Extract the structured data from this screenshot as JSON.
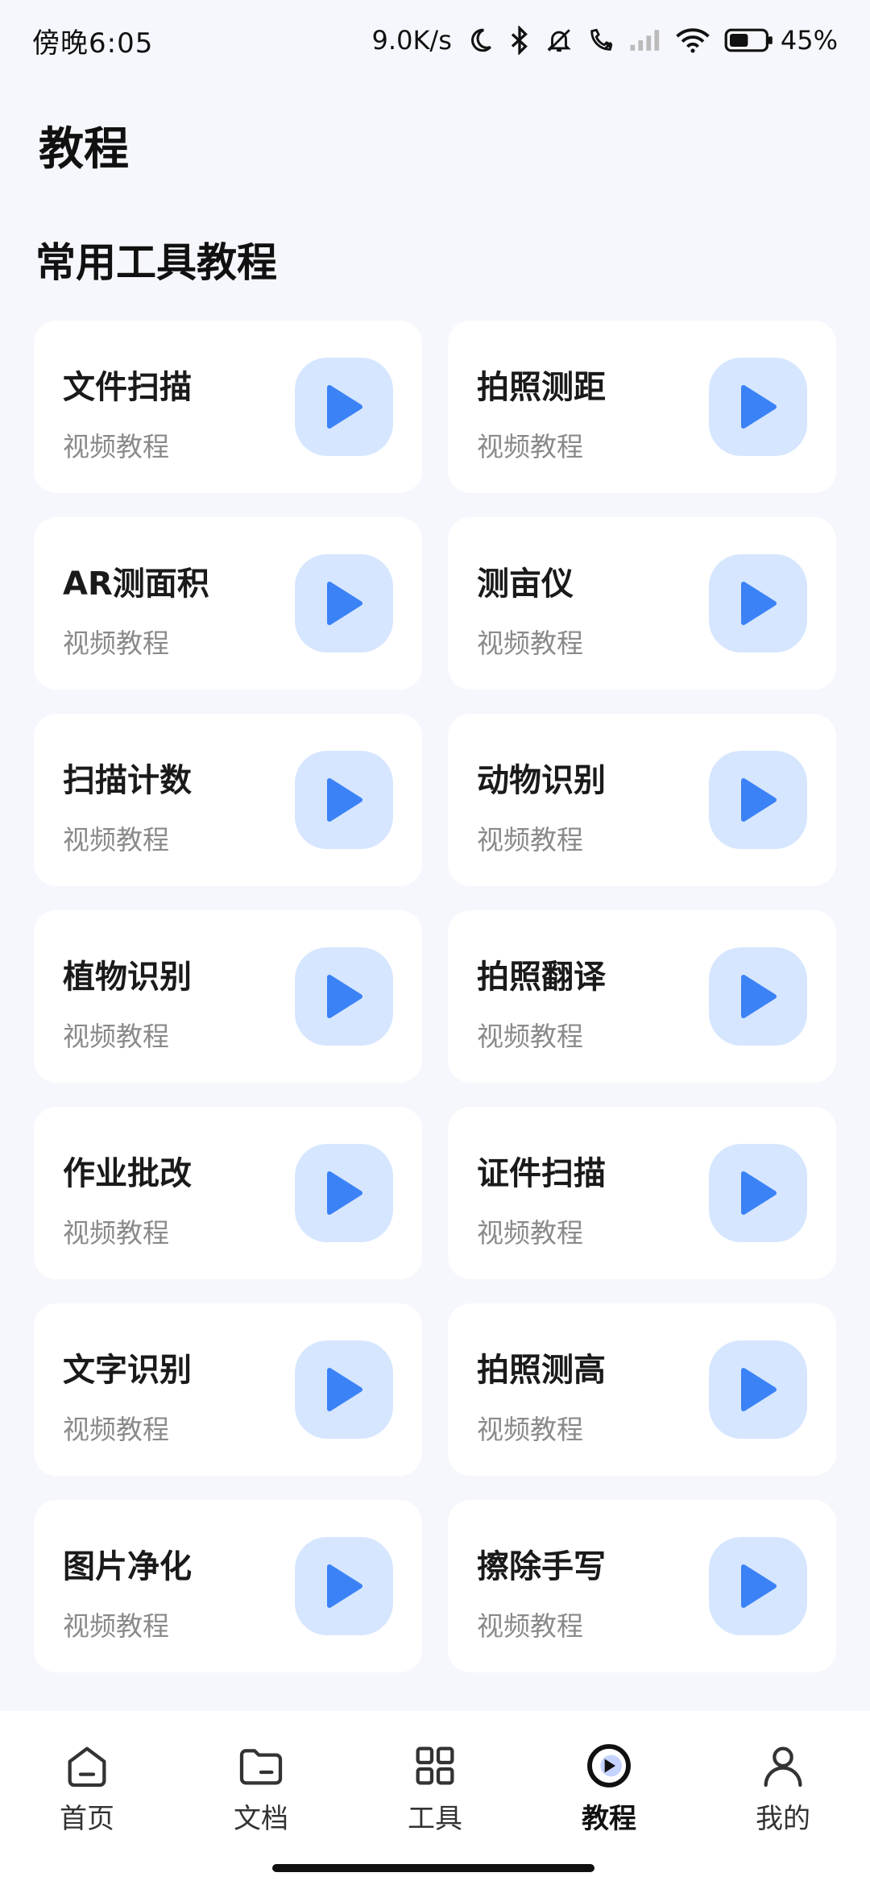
{
  "status": {
    "time": "傍晚6:05",
    "speed": "9.0K/s",
    "battery": "45%"
  },
  "header": {
    "title": "教程"
  },
  "section": {
    "title": "常用工具教程"
  },
  "cards": [
    {
      "title": "文件扫描",
      "subtitle": "视频教程"
    },
    {
      "title": "拍照测距",
      "subtitle": "视频教程"
    },
    {
      "title": "AR测面积",
      "subtitle": "视频教程"
    },
    {
      "title": "测亩仪",
      "subtitle": "视频教程"
    },
    {
      "title": "扫描计数",
      "subtitle": "视频教程"
    },
    {
      "title": "动物识别",
      "subtitle": "视频教程"
    },
    {
      "title": "植物识别",
      "subtitle": "视频教程"
    },
    {
      "title": "拍照翻译",
      "subtitle": "视频教程"
    },
    {
      "title": "作业批改",
      "subtitle": "视频教程"
    },
    {
      "title": "证件扫描",
      "subtitle": "视频教程"
    },
    {
      "title": "文字识别",
      "subtitle": "视频教程"
    },
    {
      "title": "拍照测高",
      "subtitle": "视频教程"
    },
    {
      "title": "图片净化",
      "subtitle": "视频教程"
    },
    {
      "title": "擦除手写",
      "subtitle": "视频教程"
    }
  ],
  "nav": {
    "items": [
      {
        "label": "首页",
        "icon": "home-icon"
      },
      {
        "label": "文档",
        "icon": "folder-icon"
      },
      {
        "label": "工具",
        "icon": "grid-icon"
      },
      {
        "label": "教程",
        "icon": "play-circle-icon",
        "active": true
      },
      {
        "label": "我的",
        "icon": "user-icon"
      }
    ]
  },
  "colors": {
    "accent": "#3B82F6",
    "play_bg": "#D6E6FF",
    "page_bg": "#F5F7FC"
  }
}
